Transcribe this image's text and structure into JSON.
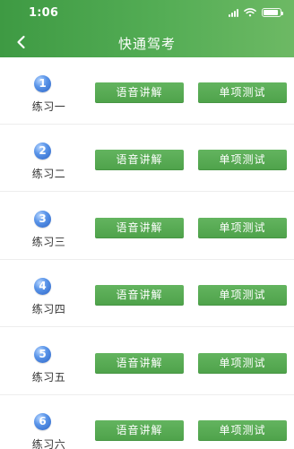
{
  "status": {
    "time": "1:06"
  },
  "header": {
    "title": "快通驾考"
  },
  "icons": {
    "back": "back-arrow-icon",
    "signal": "signal-icon",
    "wifi": "wifi-icon",
    "battery": "battery-icon"
  },
  "list": {
    "items": [
      {
        "number": "1",
        "label": "练习一",
        "voice_button": "语音讲解",
        "test_button": "单项测试"
      },
      {
        "number": "2",
        "label": "练习二",
        "voice_button": "语音讲解",
        "test_button": "单项测试"
      },
      {
        "number": "3",
        "label": "练习三",
        "voice_button": "语音讲解",
        "test_button": "单项测试"
      },
      {
        "number": "4",
        "label": "练习四",
        "voice_button": "语音讲解",
        "test_button": "单项测试"
      },
      {
        "number": "5",
        "label": "练习五",
        "voice_button": "语音讲解",
        "test_button": "单项测试"
      },
      {
        "number": "6",
        "label": "练习六",
        "voice_button": "语音讲解",
        "test_button": "单项测试"
      }
    ]
  },
  "colors": {
    "header": "#4ea74f",
    "button": "#58ab54",
    "badge": "#3f7fe0"
  }
}
